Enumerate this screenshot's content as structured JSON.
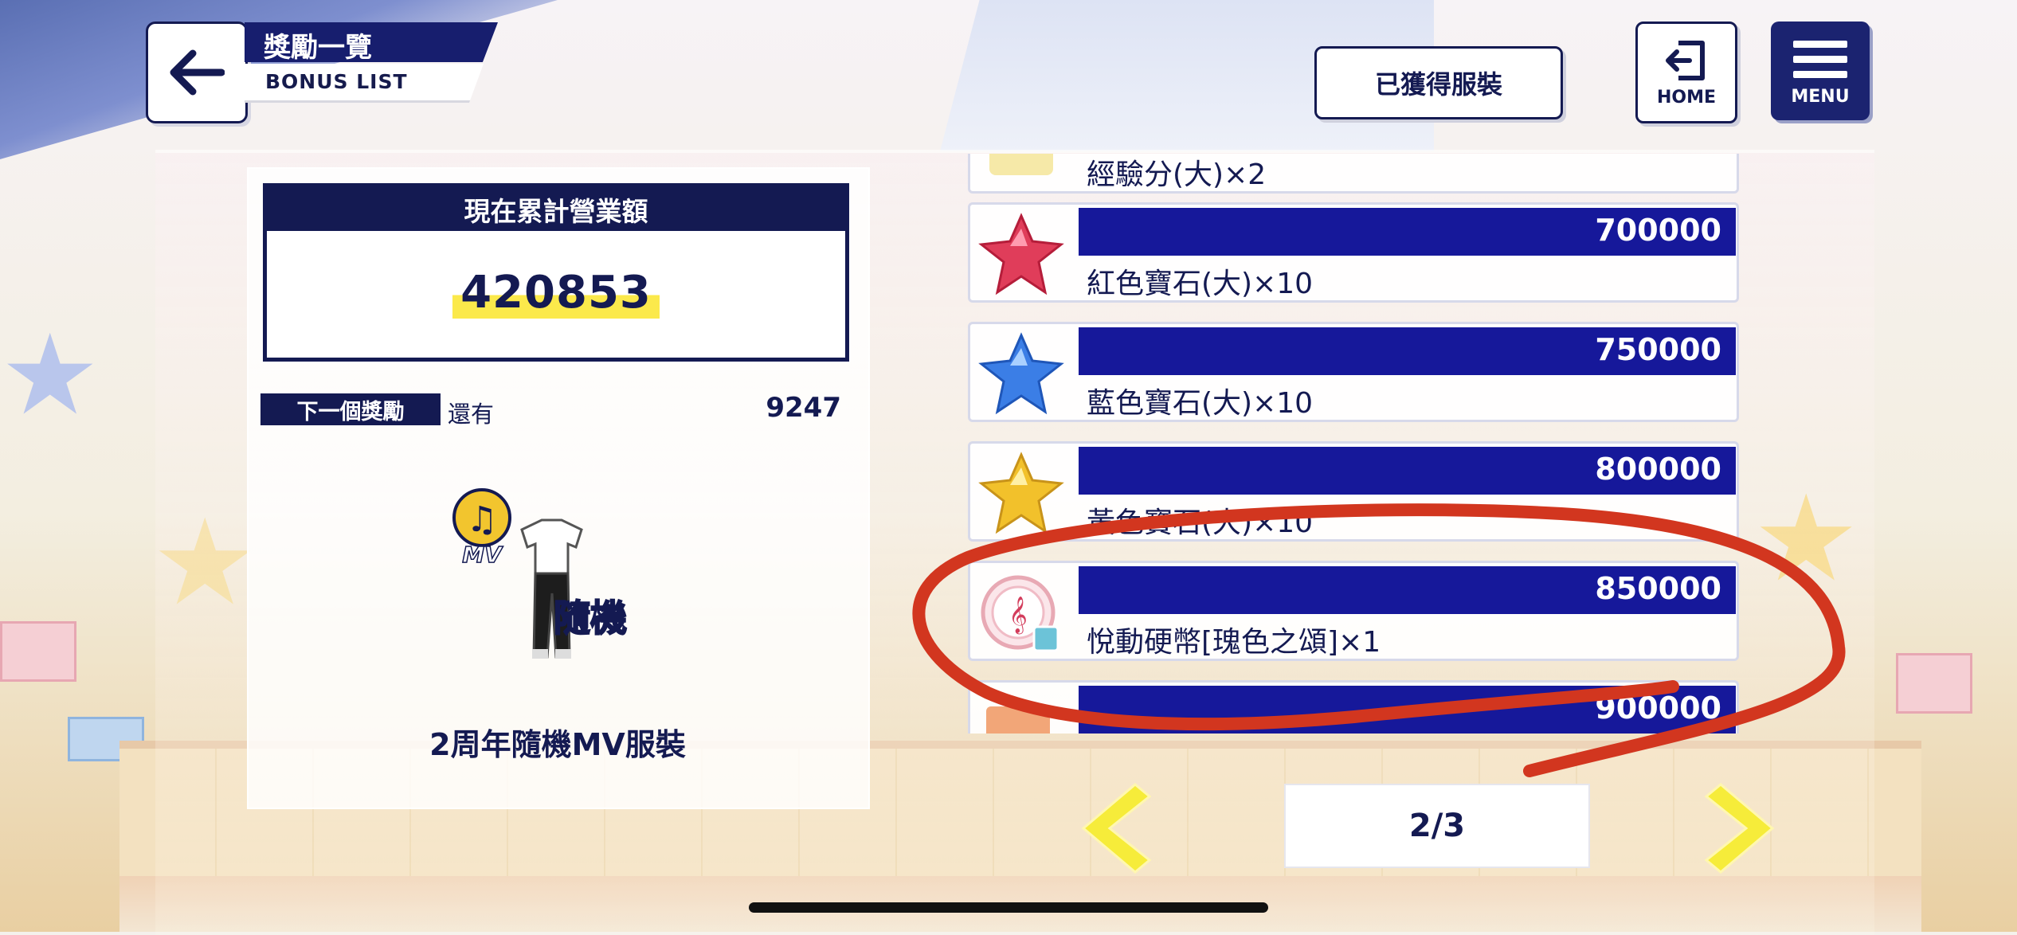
{
  "header": {
    "title_zh": "獎勵一覽",
    "title_en": "BONUS LIST",
    "outfit_button": "已獲得服裝",
    "home_label": "HOME",
    "menu_label": "MENU"
  },
  "left_panel": {
    "sales_heading": "現在累計營業額",
    "sales_value": "420853",
    "next_tag": "下一個獎勵",
    "next_remaining_label": "還有",
    "next_remaining_value": "9247",
    "reward_mv_badge": "MV",
    "reward_random_label": "隨機",
    "reward_name": "2周年隨機MV服裝"
  },
  "bonus_list": {
    "rows": [
      {
        "threshold": "",
        "name": "經驗分(大)×2"
      },
      {
        "threshold": "700000",
        "name": "紅色寶石(大)×10"
      },
      {
        "threshold": "750000",
        "name": "藍色寶石(大)×10"
      },
      {
        "threshold": "800000",
        "name": "黃色寶石(大)×10"
      },
      {
        "threshold": "850000",
        "name": "悅動硬幣[瑰色之頌]×1"
      },
      {
        "threshold": "900000",
        "name": ""
      }
    ]
  },
  "pagination": {
    "label": "2/3"
  },
  "colors": {
    "navy": "#141a52",
    "bar_blue": "#16189a",
    "highlight": "#fbe94b",
    "annotation_red": "#d2361f"
  }
}
